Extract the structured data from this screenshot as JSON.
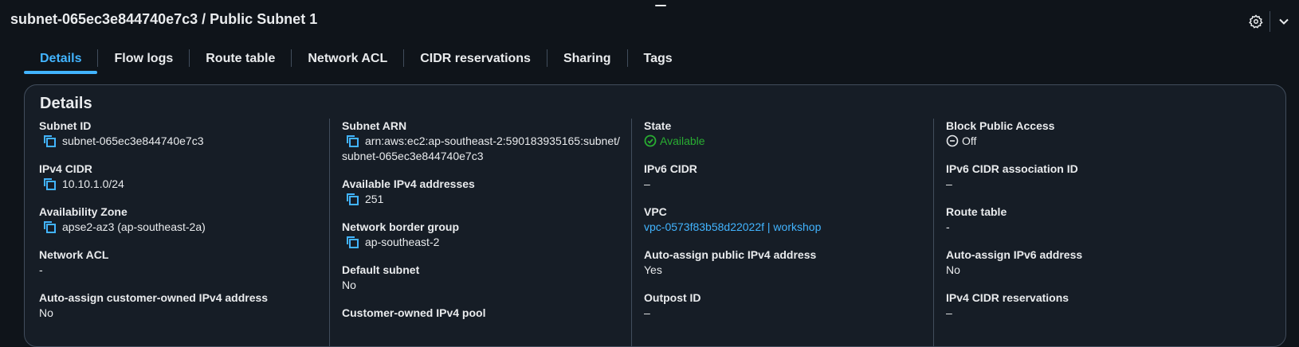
{
  "header": {
    "title": "subnet-065ec3e844740e7c3 / Public Subnet 1",
    "settings_icon": "gear-icon",
    "collapse_icon": "chevron-down-icon"
  },
  "tabs": [
    {
      "label": "Details",
      "active": true
    },
    {
      "label": "Flow logs"
    },
    {
      "label": "Route table"
    },
    {
      "label": "Network ACL"
    },
    {
      "label": "CIDR reservations"
    },
    {
      "label": "Sharing"
    },
    {
      "label": "Tags"
    }
  ],
  "details": {
    "title": "Details",
    "col1": {
      "subnet_id": {
        "label": "Subnet ID",
        "value": "subnet-065ec3e844740e7c3"
      },
      "ipv4_cidr": {
        "label": "IPv4 CIDR",
        "value": "10.10.1.0/24"
      },
      "az": {
        "label": "Availability Zone",
        "value": "apse2-az3 (ap-southeast-2a)"
      },
      "network_acl": {
        "label": "Network ACL",
        "value": "-"
      },
      "auto_customer": {
        "label": "Auto-assign customer-owned IPv4 address",
        "value": "No"
      }
    },
    "col2": {
      "subnet_arn": {
        "label": "Subnet ARN",
        "value_line1": "arn:aws:ec2:ap-southeast-2:590183935165:subnet/",
        "value_line2": "subnet-065ec3e844740e7c3"
      },
      "available_ipv4": {
        "label": "Available IPv4 addresses",
        "value": "251"
      },
      "border_group": {
        "label": "Network border group",
        "value": "ap-southeast-2"
      },
      "default_subnet": {
        "label": "Default subnet",
        "value": "No"
      },
      "customer_pool": {
        "label": "Customer-owned IPv4 pool"
      }
    },
    "col3": {
      "state": {
        "label": "State",
        "value": "Available",
        "color": "#29ad32"
      },
      "ipv6_cidr": {
        "label": "IPv6 CIDR",
        "value": "–"
      },
      "vpc": {
        "label": "VPC",
        "value": "vpc-0573f83b58d22022f | workshop",
        "color": "#42b4ff"
      },
      "auto_public": {
        "label": "Auto-assign public IPv4 address",
        "value": "Yes"
      },
      "outpost": {
        "label": "Outpost ID",
        "value": "–"
      }
    },
    "col4": {
      "block_public": {
        "label": "Block Public Access",
        "value": "Off"
      },
      "ipv6_assoc": {
        "label": "IPv6 CIDR association ID",
        "value": "–"
      },
      "route_table": {
        "label": "Route table",
        "value": "-"
      },
      "auto_ipv6": {
        "label": "Auto-assign IPv6 address",
        "value": "No"
      },
      "ipv4_reservations": {
        "label": "IPv4 CIDR reservations",
        "value": "–"
      }
    }
  }
}
